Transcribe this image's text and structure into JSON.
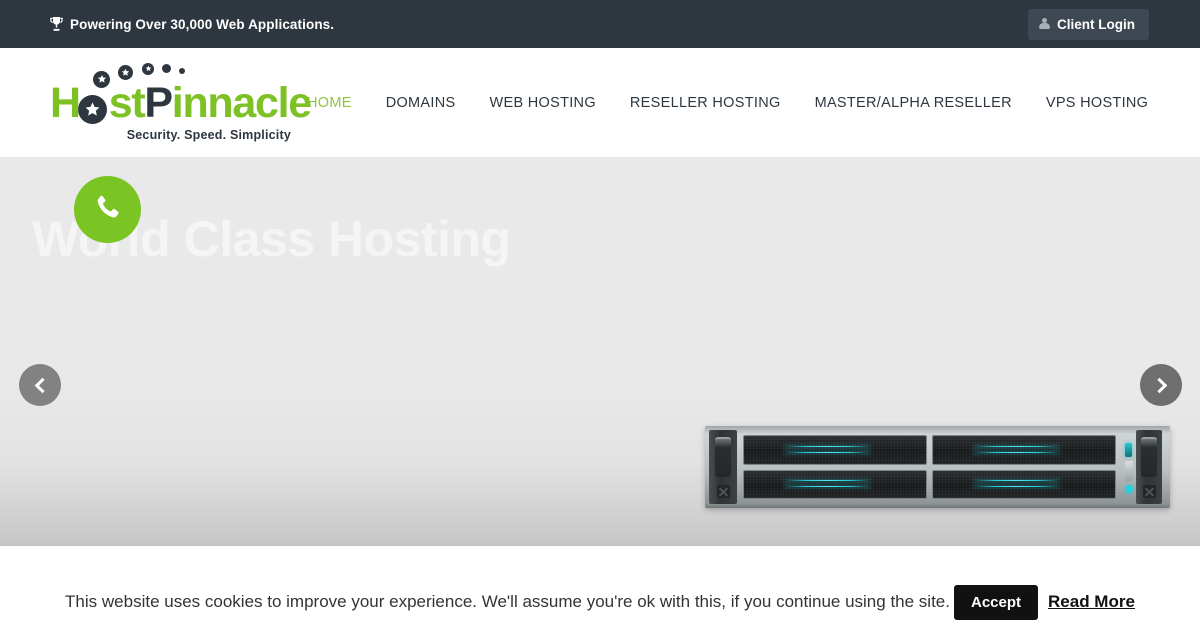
{
  "topbar": {
    "promo_text": "Powering Over 30,000 Web Applications.",
    "trophy_icon": "trophy-icon",
    "client_login_label": "Client Login",
    "user_icon": "user-icon",
    "bg_color": "#2e3740",
    "button_bg_color": "#3e4852"
  },
  "header": {
    "logo": {
      "part1": "H",
      "part_o": "o",
      "part2": "st",
      "part3": "Pinnacle",
      "tagline": "Security. Speed. Simplicity",
      "green": "#7dc124",
      "dark": "#2e3740"
    },
    "nav": [
      {
        "label": "HOME",
        "active": true
      },
      {
        "label": "DOMAINS",
        "active": false
      },
      {
        "label": "WEB HOSTING",
        "active": false
      },
      {
        "label": "RESELLER HOSTING",
        "active": false
      },
      {
        "label": "MASTER/ALPHA RESELLER",
        "active": false
      },
      {
        "label": "VPS HOSTING",
        "active": false
      }
    ],
    "active_color": "#8cc63f"
  },
  "hero": {
    "title": "World Class Hosting",
    "call_button_icon": "phone-icon",
    "call_button_color": "#7ac423",
    "prev_arrow_icon": "chevron-left-icon",
    "next_arrow_icon": "chevron-right-icon",
    "server_image_alt": "rack-server-illustration"
  },
  "cookie_bar": {
    "message": "This website uses cookies to improve your experience. We'll assume you're ok with this, if you continue using the site.",
    "accept_label": "Accept",
    "read_more_label": "Read More",
    "accept_bg_color": "#111111"
  }
}
